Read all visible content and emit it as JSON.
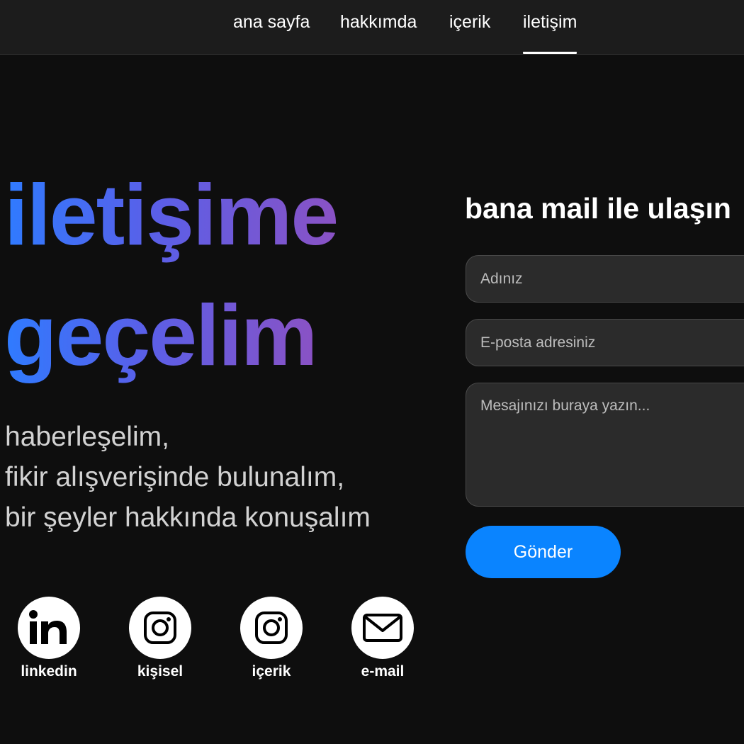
{
  "nav": {
    "items": [
      {
        "label": "ana sayfa"
      },
      {
        "label": "hakkımda"
      },
      {
        "label": "içerik"
      },
      {
        "label": "iletişim",
        "active": true
      }
    ]
  },
  "hero": {
    "title_line1": "iletişime",
    "title_line2": "geçelim",
    "gradient_colors": [
      "#2f7bff",
      "#8a52c4"
    ],
    "tagline": [
      "haberleşelim,",
      "fikir alışverişinde bulunalım,",
      "bir şeyler hakkında konuşalım"
    ]
  },
  "social": [
    {
      "label": "linkedin",
      "icon": "linkedin-icon"
    },
    {
      "label": "kişisel",
      "icon": "instagram-icon"
    },
    {
      "label": "içerik",
      "icon": "instagram-icon"
    },
    {
      "label": "e-mail",
      "icon": "mail-icon"
    }
  ],
  "form": {
    "title": "bana mail ile ulaşın",
    "name_placeholder": "Adınız",
    "email_placeholder": "E-posta adresiniz",
    "message_placeholder": "Mesajınızı buraya yazın...",
    "submit_label": "Gönder",
    "submit_color": "#0a84ff"
  }
}
